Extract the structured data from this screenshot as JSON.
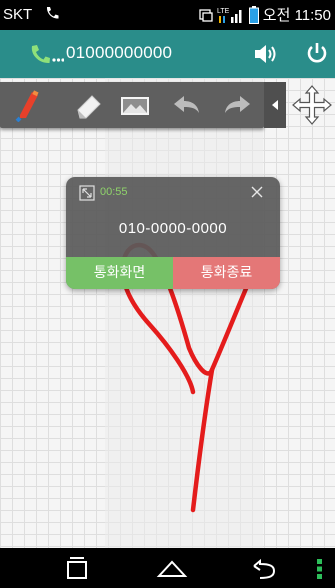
{
  "status_bar": {
    "carrier": "SKT",
    "network": "LTE",
    "clock": "오전 11:50"
  },
  "call_bar": {
    "number": "01000000000"
  },
  "toolbar": {
    "tools": [
      "pen-icon",
      "eraser-icon",
      "image-icon",
      "undo-icon",
      "redo-icon"
    ],
    "pen_color": "#e8402a"
  },
  "popup": {
    "timer": "00:55",
    "number": "010-0000-0000",
    "btn_screen": "통화화면",
    "btn_end": "통화종료"
  },
  "drawing": {
    "stroke_color": "#e41c1c"
  },
  "colors": {
    "call_bar_bg": "#2a8d8a",
    "btn_screen": "#76c167",
    "btn_end": "#e47777",
    "timer": "#8fd36b"
  }
}
